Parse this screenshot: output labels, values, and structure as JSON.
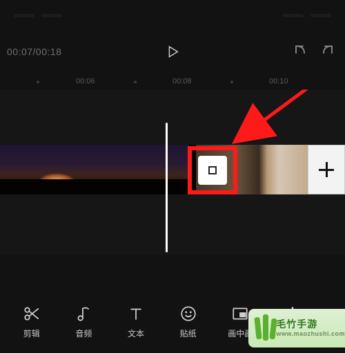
{
  "transport": {
    "time": "00:07/00:18"
  },
  "ruler": {
    "ticks": [
      "00:06",
      "00:08",
      "00:10"
    ]
  },
  "toolbar": {
    "items": [
      {
        "id": "cut",
        "label": "剪辑"
      },
      {
        "id": "audio",
        "label": "音频"
      },
      {
        "id": "text",
        "label": "文本"
      },
      {
        "id": "sticker",
        "label": "贴纸"
      },
      {
        "id": "pip",
        "label": "画中画"
      }
    ]
  },
  "watermark": {
    "line1": "毛竹手游",
    "line2": "www.maozhushi.com"
  },
  "annotation": {
    "arrow_color": "#ff1a1a"
  }
}
